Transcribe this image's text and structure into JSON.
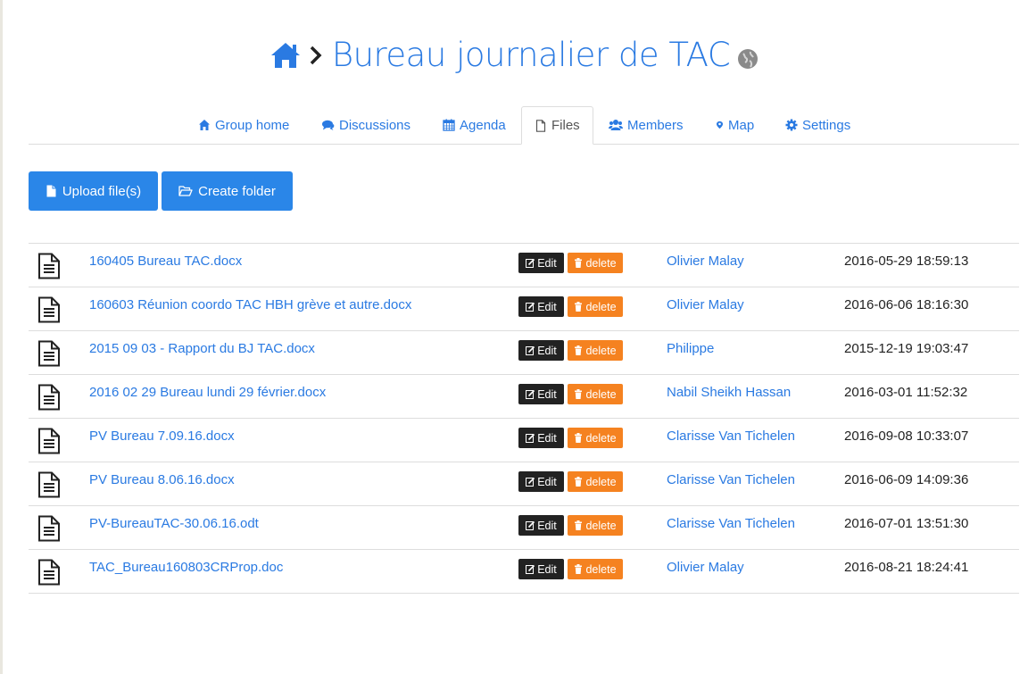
{
  "header": {
    "title": "Bureau journalier de TAC",
    "brand_color": "#2a7ae2"
  },
  "tabs": [
    {
      "label": "Group home",
      "icon": "home-icon"
    },
    {
      "label": "Discussions",
      "icon": "comments-icon"
    },
    {
      "label": "Agenda",
      "icon": "calendar-icon"
    },
    {
      "label": "Files",
      "icon": "file-icon",
      "active": true
    },
    {
      "label": "Members",
      "icon": "users-icon"
    },
    {
      "label": "Map",
      "icon": "map-marker-icon"
    },
    {
      "label": "Settings",
      "icon": "gear-icon"
    }
  ],
  "actions": {
    "upload_label": "Upload file(s)",
    "create_folder_label": "Create folder"
  },
  "files": [
    {
      "name": "160405 Bureau TAC.docx",
      "author": "Olivier Malay",
      "date": "2016-05-29 18:59:13",
      "edit": "Edit",
      "delete": "delete"
    },
    {
      "name": "160603 Réunion coordo TAC HBH grève et autre.docx",
      "author": "Olivier Malay",
      "date": "2016-06-06 18:16:30",
      "edit": "Edit",
      "delete": "delete"
    },
    {
      "name": "2015 09 03 - Rapport du BJ TAC.docx",
      "author": "Philippe",
      "date": "2015-12-19 19:03:47",
      "edit": "Edit",
      "delete": "delete"
    },
    {
      "name": "2016 02 29 Bureau lundi 29 février.docx",
      "author": "Nabil Sheikh Hassan",
      "date": "2016-03-01 11:52:32",
      "edit": "Edit",
      "delete": "delete"
    },
    {
      "name": "PV Bureau 7.09.16.docx",
      "author": "Clarisse Van Tichelen",
      "date": "2016-09-08 10:33:07",
      "edit": "Edit",
      "delete": "delete"
    },
    {
      "name": "PV Bureau 8.06.16.docx",
      "author": "Clarisse Van Tichelen",
      "date": "2016-06-09 14:09:36",
      "edit": "Edit",
      "delete": "delete"
    },
    {
      "name": "PV-BureauTAC-30.06.16.odt",
      "author": "Clarisse Van Tichelen",
      "date": "2016-07-01 13:51:30",
      "edit": "Edit",
      "delete": "delete"
    },
    {
      "name": "TAC_Bureau160803CRProp.doc",
      "author": "Olivier Malay",
      "date": "2016-08-21 18:24:41",
      "edit": "Edit",
      "delete": "delete"
    }
  ]
}
